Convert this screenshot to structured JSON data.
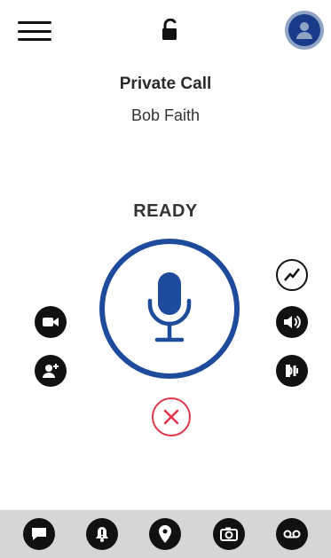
{
  "header": {
    "menu_icon": "hamburger-menu-icon",
    "lock_icon": "unlocked-padlock-icon",
    "avatar_icon": "user-avatar-icon"
  },
  "call": {
    "type": "Private Call",
    "name": "Bob Faith",
    "status": "READY"
  },
  "ptt": {
    "icon": "microphone-icon",
    "color": "#1e4b9c"
  },
  "left_actions": [
    {
      "icon": "video-camera-icon"
    },
    {
      "icon": "add-contact-icon"
    }
  ],
  "right_actions": [
    {
      "icon": "signal-trend-icon"
    },
    {
      "icon": "speaker-volume-icon"
    },
    {
      "icon": "earpiece-icon"
    }
  ],
  "end_call": {
    "icon": "close-x-icon",
    "color": "#e0364a"
  },
  "bottom_bar": [
    {
      "icon": "chat-bubble-icon"
    },
    {
      "icon": "alert-bell-icon"
    },
    {
      "icon": "location-pin-icon"
    },
    {
      "icon": "camera-icon"
    },
    {
      "icon": "voicemail-icon"
    }
  ],
  "colors": {
    "accent": "#1e4b9c",
    "danger": "#e0364a",
    "bottom_bar_bg": "#d6d6d6"
  }
}
